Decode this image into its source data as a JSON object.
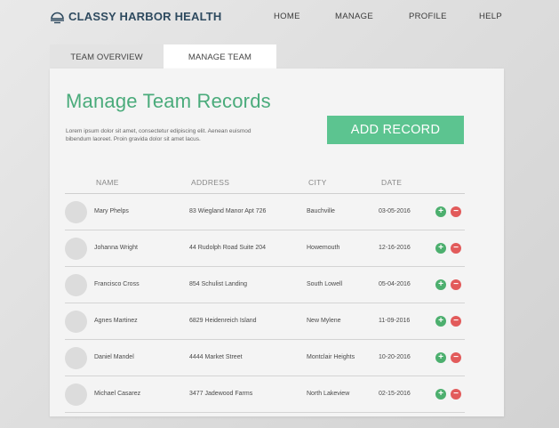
{
  "header": {
    "brand": "CLASSY HARBOR HEALTH",
    "brand_color": "#2e4a5f",
    "logo_icon": "lamp-icon",
    "nav": {
      "home": "HOME",
      "manage": "MANAGE",
      "profile": "PROFILE",
      "help": "HELP"
    }
  },
  "tabs": {
    "overview": "TEAM OVERVIEW",
    "manage": "MANAGE TEAM",
    "active": "MANAGE TEAM"
  },
  "main": {
    "title": "Manage Team Records",
    "description": "Lorem ipsum dolor sit amet, consectetur edipiscing elit. Aenean euismod bibendum laoreet. Proin gravida dolor sit amet lacus.",
    "add_button": "ADD RECORD",
    "accent_color": "#5cc490"
  },
  "table": {
    "columns": {
      "name": "NAME",
      "address": "ADDRESS",
      "city": "CITY",
      "date": "DATE"
    },
    "rows": [
      {
        "name": "Mary Phelps",
        "address": "83 Wiegland Manor Apt 726",
        "city": "Bauchville",
        "date": "03-05-2016"
      },
      {
        "name": "Johanna Wright",
        "address": "44 Rudolph Road Suite 204",
        "city": "Howemouth",
        "date": "12-16-2016"
      },
      {
        "name": "Francisco Cross",
        "address": "854 Schulist Landing",
        "city": "South Lowell",
        "date": "05-04-2016"
      },
      {
        "name": "Agnes Martinez",
        "address": "6829 Heidenreich Island",
        "city": "New Mylene",
        "date": "11-09-2016"
      },
      {
        "name": "Daniel Mandel",
        "address": "4444 Market Street",
        "city": "Montclair Heights",
        "date": "10-20-2016"
      },
      {
        "name": "Michael Casarez",
        "address": "3477 Jadewood Farms",
        "city": "North Lakeview",
        "date": "02-15-2016"
      }
    ],
    "actions": {
      "add_icon": "plus-icon",
      "remove_icon": "minus-icon",
      "add_symbol": "+",
      "remove_symbol": "−"
    }
  }
}
